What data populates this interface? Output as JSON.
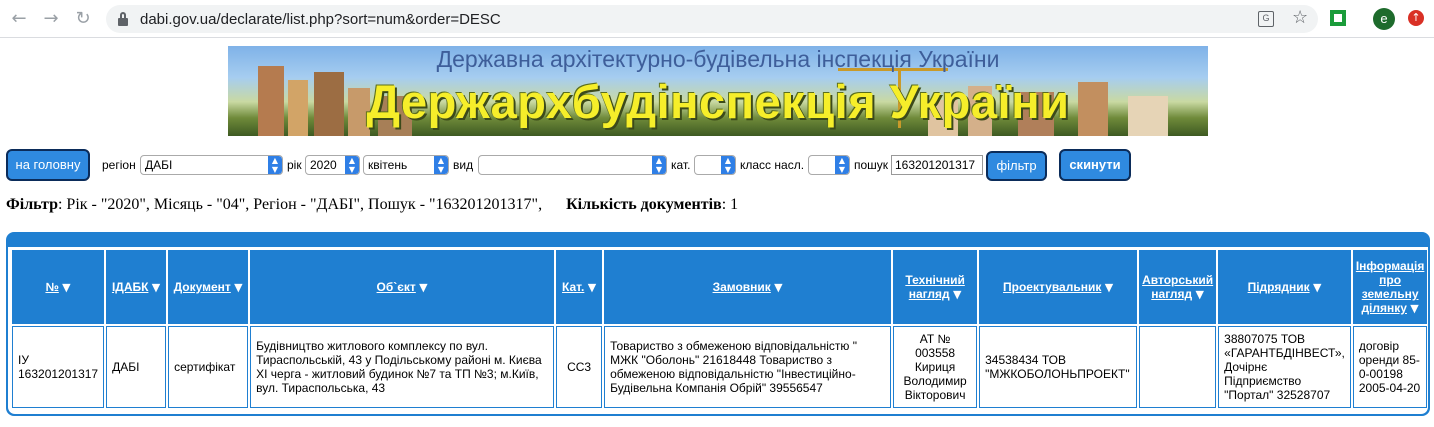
{
  "browser": {
    "url": "dabi.gov.ua/declarate/list.php?sort=num&order=DESC",
    "avatar_letter": "e"
  },
  "banner": {
    "subtitle": "Державна архітектурно-будівельна інспекція України",
    "title": "Держархбудінспекція України"
  },
  "toolbar": {
    "home_label": "на головну",
    "region_label": "регіон",
    "region_value": "ДАБІ",
    "year_label": "рік",
    "year_value": "2020",
    "month_value": "квітень",
    "type_label": "вид",
    "type_value": "",
    "cat_label": "кат.",
    "cat_value": "",
    "class_label": "класс насл.",
    "class_value": "",
    "search_label": "пошук",
    "search_value": "163201201317",
    "filter_label": "фільтр",
    "reset_label": "скинути"
  },
  "filter_summary": {
    "filter_label": "Фільтр",
    "filter_text": ": Рік - \"2020\", Місяць - \"04\", Регіон - \"ДАБІ\", Пошук - \"163201201317\",",
    "count_label": "Кількість документів",
    "count_text": ": 1"
  },
  "table": {
    "headers": [
      "№",
      "ІДАБК",
      "Документ",
      "Об`єкт",
      "Кат.",
      "Замовник",
      "Технічний нагляд",
      "Проектувальник",
      "Авторський нагляд",
      "Підрядник",
      "Інформація про земельну ділянку"
    ],
    "rows": [
      {
        "num": "ІУ 163201201317",
        "idabk": "ДАБІ",
        "doc": "сертифікат",
        "object": "Будівництво житлового комплексу по вул. Тираспольській, 43 у Подільському районі м. Києва ХІ черга - житловий будинок №7 та ТП №3; м.Київ, вул. Тираспольська, 43",
        "cat": "СС3",
        "customer": "Товариство з обмеженою відповідальністю \" МЖК \"Оболонь\" 21618448 Товариство з обмеженою відповідальністю \"Інвестиційно-Будівельна Компанія Обрій\" 39556547",
        "tech": "АТ № 003558 Кириця Володимир Вікторович",
        "designer": "34538434 ТОВ \"МЖКОБОЛОНЬПРОЕКТ\"",
        "author": "",
        "contractor": "38807075 ТОВ «ГАРАНТБДІНВЕСТ», Дочірнє Підприємство \"Портал\" 32528707",
        "land": "договір оренди 85-0-00198 2005-04-20"
      }
    ]
  },
  "icons": {
    "back": "arrow-left-icon",
    "forward": "arrow-right-icon",
    "reload": "reload-icon",
    "lock": "lock-icon",
    "translate": "translate-icon",
    "star": "star-icon",
    "sort": "sort-down-icon"
  },
  "colors": {
    "accent": "#1f7fd1",
    "button_border": "#0b2c5a",
    "banner_title": "#f6ee2a"
  }
}
